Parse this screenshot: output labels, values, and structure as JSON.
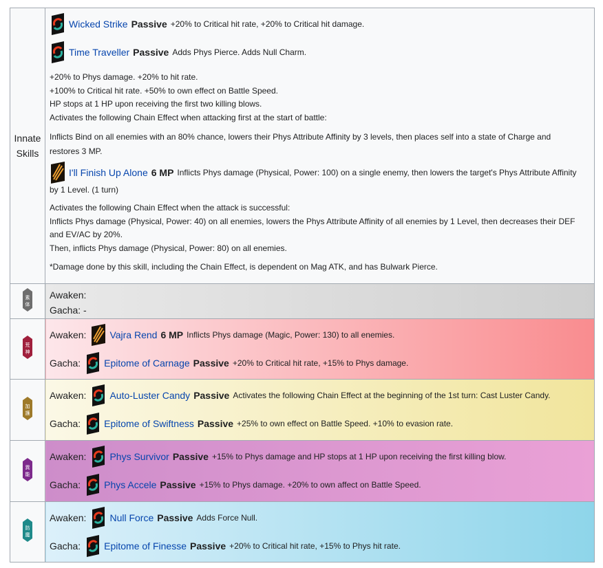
{
  "innate": {
    "label_line1": "Innate",
    "label_line2": "Skills",
    "skills": [
      {
        "name": "Wicked Strike",
        "tag": "Passive",
        "desc": "+20% to Critical hit rate, +20% to Critical hit damage.",
        "icon": "passive-swirl-icon"
      },
      {
        "name": "Time Traveller",
        "tag": "Passive",
        "desc": "Adds Phys Pierce. Adds Null Charm.",
        "icon": "passive-swirl-icon"
      }
    ],
    "block1": [
      "+20% to Phys damage. +20% to hit rate.",
      "+100% to Critical hit rate. +50% to own effect on Battle Speed.",
      "HP stops at 1 HP upon receiving the first two killing blows.",
      "Activates the following Chain Effect when attacking first at the start of battle:"
    ],
    "block2_line1": "Inflicts Bind on all enemies with an 80% chance, lowers their Phys Attribute Affinity by 3 levels, then places self into a state of Charge and",
    "block2_line2": "restores 3 MP.",
    "active": {
      "name": "I'll Finish Up Alone",
      "tag": "6 MP",
      "desc": "Inflicts Phys damage (Physical, Power: 100) on a single enemy, then lowers the target's Phys Attribute Affinity",
      "desc2": "by 1 Level. (1 turn)",
      "icon": "phys-slash-icon"
    },
    "block3": [
      "Activates the following Chain Effect when the attack is successful:",
      "Inflicts Phys damage (Physical, Power: 40) on all enemies, lowers the Phys Attribute Affinity of all enemies by 1 Level, then decreases their DEF",
      "and EV/AC by 20%.",
      "Then, inflicts Phys damage (Physical, Power: 80) on all enemies."
    ],
    "note": "*Damage done by this skill, including the Chain Effect, is dependent on Mag ATK, and has Bulwark Pierce."
  },
  "rows": [
    {
      "crest": "素体",
      "color": "#6e6e6e",
      "bg": "linear-gradient(90deg,#ececec,#d0d0d0)",
      "awaken": {
        "label": "Awaken:",
        "name": "",
        "tag": "",
        "desc": ""
      },
      "gacha": {
        "label": "Gacha: -",
        "name": "",
        "tag": "",
        "desc": ""
      }
    },
    {
      "crest": "荒神",
      "color": "#a01f3c",
      "bg": "linear-gradient(90deg,#fde8ec,#f98f91)",
      "awaken": {
        "label": "Awaken:",
        "name": "Vajra Rend",
        "tag": "6 MP",
        "desc": "Inflicts Phys damage (Magic, Power: 130) to all enemies.",
        "icon": "phys-slash-icon"
      },
      "gacha": {
        "label": "Gacha:",
        "name": "Epitome of Carnage",
        "tag": "Passive",
        "desc": "+20% to Critical hit rate, +15% to Phys damage.",
        "icon": "passive-swirl-icon"
      }
    },
    {
      "crest": "加護",
      "color": "#9e7a2a",
      "bg": "linear-gradient(90deg,#fbf8e6,#f1e6a0)",
      "awaken": {
        "label": "Awaken:",
        "name": "Auto-Luster Candy",
        "tag": "Passive",
        "desc": "Activates the following Chain Effect at the beginning of the 1st turn: Cast Luster Candy.",
        "icon": "passive-swirl-icon"
      },
      "gacha": {
        "label": "Gacha:",
        "name": "Epitome of Swiftness",
        "tag": "Passive",
        "desc": "+25% to own effect on Battle Speed. +10% to evasion rate.",
        "icon": "passive-swirl-icon"
      }
    },
    {
      "crest": "異能",
      "color": "#7d2a8c",
      "bg": "linear-gradient(90deg,#cf8fcc,#eaa1d6)",
      "awaken": {
        "label": "Awaken:",
        "name": "Phys Survivor",
        "tag": "Passive",
        "desc": "+15% to Phys damage and HP stops at 1 HP upon receiving the first killing blow.",
        "icon": "passive-swirl-icon"
      },
      "gacha": {
        "label": "Gacha:",
        "name": "Phys Accele",
        "tag": "Passive",
        "desc": "+15% to Phys damage. +20% to own affect on Battle Speed.",
        "icon": "passive-swirl-icon"
      }
    },
    {
      "crest": "防魔",
      "color": "#1f8a8a",
      "bg": "linear-gradient(90deg,#ddf1fb,#8fd6ea)",
      "awaken": {
        "label": "Awaken:",
        "name": "Null Force",
        "tag": "Passive",
        "desc": "Adds Force Null.",
        "icon": "passive-swirl-icon"
      },
      "gacha": {
        "label": "Gacha:",
        "name": "Epitome of Finesse",
        "tag": "Passive",
        "desc": "+20% to Critical hit rate, +15% to Phys hit rate.",
        "icon": "passive-swirl-icon"
      }
    }
  ]
}
